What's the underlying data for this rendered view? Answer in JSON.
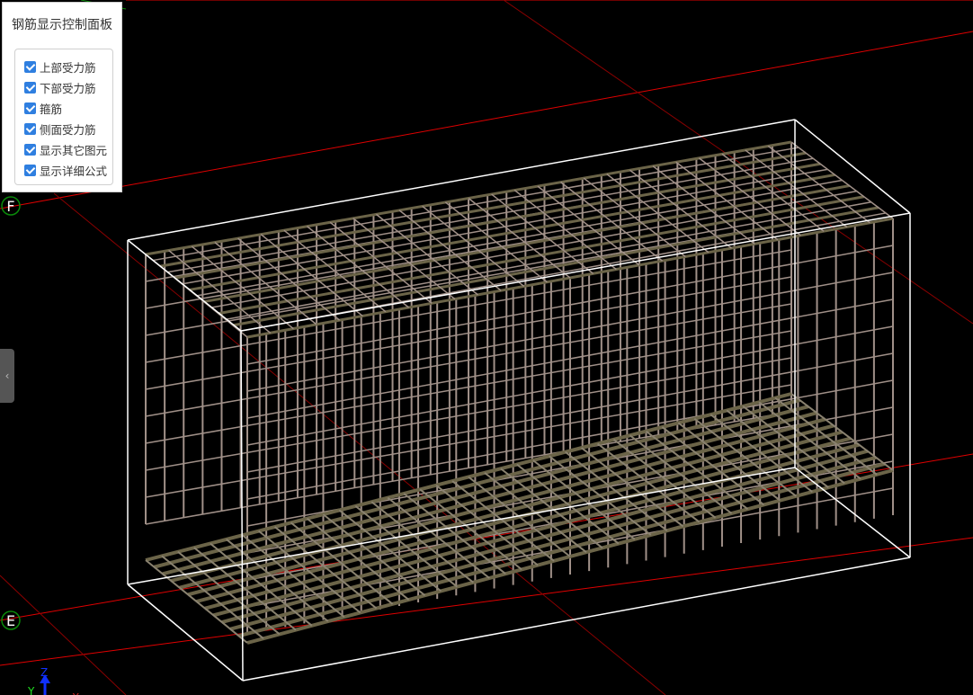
{
  "panel": {
    "title": "钢筋显示控制面板",
    "options": [
      {
        "label": "上部受力筋",
        "checked": true
      },
      {
        "label": "下部受力筋",
        "checked": true
      },
      {
        "label": "箍筋",
        "checked": true
      },
      {
        "label": "侧面受力筋",
        "checked": true
      },
      {
        "label": "显示其它图元",
        "checked": true
      },
      {
        "label": "显示详细公式",
        "checked": true
      }
    ]
  },
  "axis_labels": {
    "F": "F",
    "E": "E"
  },
  "triad": {
    "z": "Z",
    "y": "Y",
    "x": "X"
  },
  "collapse_tab": "‹",
  "colors": {
    "grid": "#e00000",
    "box": "#ffffff",
    "rebar": "#a09088",
    "rebar_dark": "#6b6448",
    "axis_circle": "#0a8a0a"
  }
}
